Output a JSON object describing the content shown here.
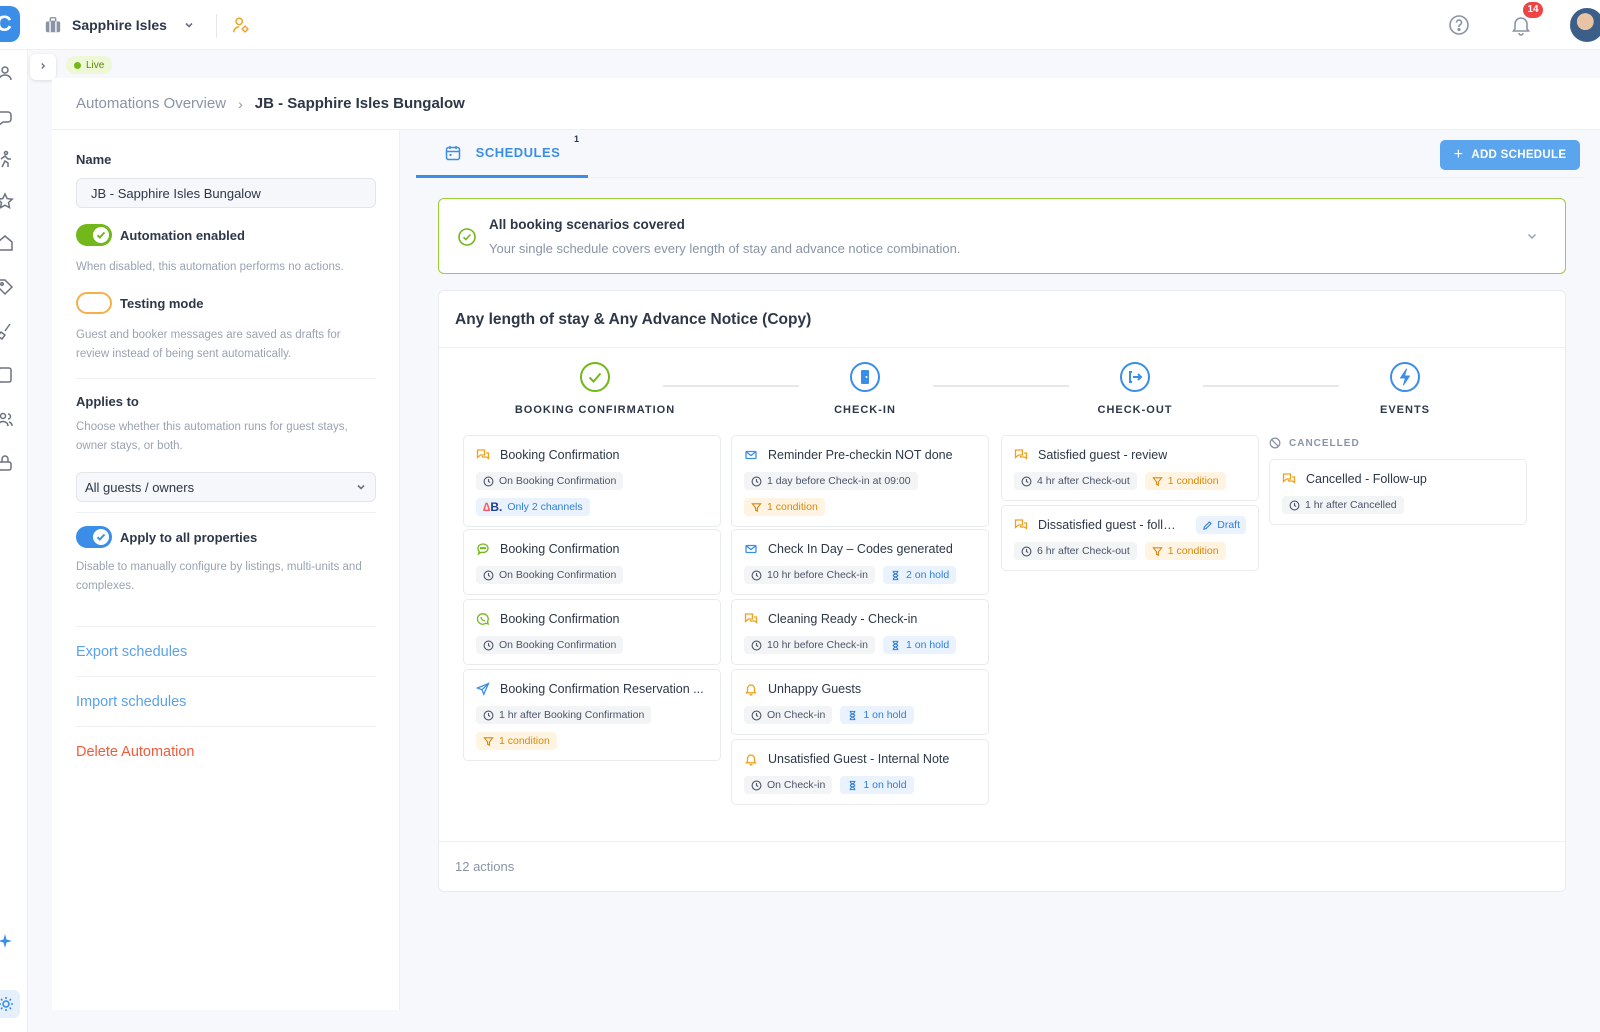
{
  "topbar": {
    "logo": "C",
    "property": "Sapphire Isles",
    "notifications_count": "14"
  },
  "status": {
    "live": "Live"
  },
  "breadcrumb": {
    "parent": "Automations Overview",
    "separator": "›",
    "current": "JB - Sapphire Isles Bungalow"
  },
  "left_panel": {
    "name_label": "Name",
    "name_value": "JB - Sapphire Isles Bungalow",
    "automation_enabled": {
      "label": "Automation enabled",
      "on": true,
      "help": "When disabled, this automation performs no actions."
    },
    "testing_mode": {
      "label": "Testing mode",
      "on": false,
      "help": "Guest and booker messages are saved as drafts for review instead of being sent automatically."
    },
    "applies_to": {
      "label": "Applies to",
      "help": "Choose whether this automation runs for guest stays, owner stays, or both.",
      "selected": "All guests / owners"
    },
    "apply_all_properties": {
      "label": "Apply to all properties",
      "on": true,
      "help": "Disable to manually configure by listings, multi-units and complexes."
    },
    "links": {
      "export": "Export schedules",
      "import": "Import schedules",
      "delete": "Delete Automation"
    }
  },
  "tabs": {
    "schedules_label": "SCHEDULES",
    "schedules_count": "1"
  },
  "add_schedule_label": "ADD SCHEDULE",
  "coverage": {
    "title": "All booking scenarios covered",
    "description": "Your single schedule covers every length of stay and advance notice combination."
  },
  "schedule": {
    "title": "Any length of stay & Any Advance Notice (Copy)",
    "stages": {
      "booking": "BOOKING CONFIRMATION",
      "checkin": "CHECK-IN",
      "checkout": "CHECK-OUT",
      "events": "EVENTS"
    },
    "events_group": "CANCELLED",
    "booking_actions": [
      {
        "title": "Booking Confirmation",
        "icon": "chat-bubbles-icon",
        "timing": "On Booking Confirmation",
        "channels": "Only 2 channels"
      },
      {
        "title": "Booking Confirmation",
        "icon": "sms-icon",
        "timing": "On Booking Confirmation"
      },
      {
        "title": "Booking Confirmation",
        "icon": "whatsapp-icon",
        "timing": "On Booking Confirmation"
      },
      {
        "title": "Booking Confirmation Reservation ...",
        "icon": "send-icon",
        "timing": "1 hr after Booking Confirmation",
        "condition": "1 condition"
      }
    ],
    "checkin_actions": [
      {
        "title": "Reminder Pre-checkin NOT done",
        "icon": "email-icon",
        "timing": "1 day before Check-in at 09:00",
        "condition": "1 condition"
      },
      {
        "title": "Check In Day – Codes generated",
        "icon": "email-icon",
        "timing": "10 hr before Check-in",
        "hold": "2 on hold"
      },
      {
        "title": "Cleaning Ready - Check-in",
        "icon": "chat-bubbles-icon",
        "timing": "10 hr before Check-in",
        "hold": "1 on hold"
      },
      {
        "title": "Unhappy Guests",
        "icon": "bell-icon",
        "timing": "On Check-in",
        "hold": "1 on hold"
      },
      {
        "title": "Unsatisfied Guest - Internal Note",
        "icon": "bell-icon",
        "timing": "On Check-in",
        "hold": "1 on hold"
      }
    ],
    "checkout_actions": [
      {
        "title": "Satisfied guest - review",
        "icon": "chat-bubbles-icon",
        "timing": "4 hr after Check-out",
        "condition": "1 condition"
      },
      {
        "title": "Dissatisfied guest - follo...",
        "icon": "chat-bubbles-icon",
        "timing": "6 hr after Check-out",
        "condition": "1 condition",
        "draft": "Draft"
      }
    ],
    "event_actions": [
      {
        "title": "Cancelled - Follow-up",
        "icon": "chat-bubbles-icon",
        "timing": "1 hr after Cancelled"
      }
    ],
    "actions_count": "12 actions"
  },
  "colors": {
    "accent": "#3b8ee8",
    "success": "#73b81a",
    "warning": "#f0a020",
    "danger": "#ef5b3c"
  }
}
